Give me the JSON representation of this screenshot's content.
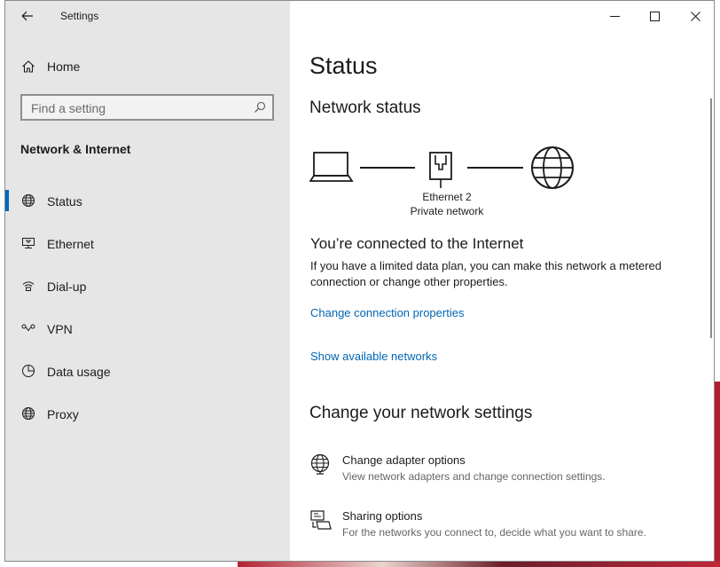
{
  "window": {
    "title": "Settings"
  },
  "sidebar": {
    "home_label": "Home",
    "search": {
      "placeholder": "Find a setting"
    },
    "section_title": "Network & Internet",
    "items": [
      {
        "label": "Status",
        "icon": "globe-icon",
        "active": true
      },
      {
        "label": "Ethernet",
        "icon": "ethernet-icon"
      },
      {
        "label": "Dial-up",
        "icon": "dialup-icon"
      },
      {
        "label": "VPN",
        "icon": "vpn-icon"
      },
      {
        "label": "Data usage",
        "icon": "data-usage-icon"
      },
      {
        "label": "Proxy",
        "icon": "globe-icon"
      }
    ]
  },
  "main": {
    "title": "Status",
    "network_status_heading": "Network status",
    "diagram": {
      "adapter_name": "Ethernet 2",
      "network_type": "Private network"
    },
    "connected_title": "You’re connected to the Internet",
    "connected_desc": "If you have a limited data plan, you can make this network a metered connection or change other properties.",
    "link_change_props": "Change connection properties",
    "link_show_networks": "Show available networks",
    "change_settings_heading": "Change your network settings",
    "settings": [
      {
        "title": "Change adapter options",
        "desc": "View network adapters and change connection settings.",
        "icon": "adapter-icon"
      },
      {
        "title": "Sharing options",
        "desc": "For the networks you connect to, decide what you want to share.",
        "icon": "sharing-icon"
      }
    ]
  },
  "colors": {
    "accent": "#0067c0",
    "link": "#0066b4",
    "sidebar_bg": "#e6e6e6"
  }
}
